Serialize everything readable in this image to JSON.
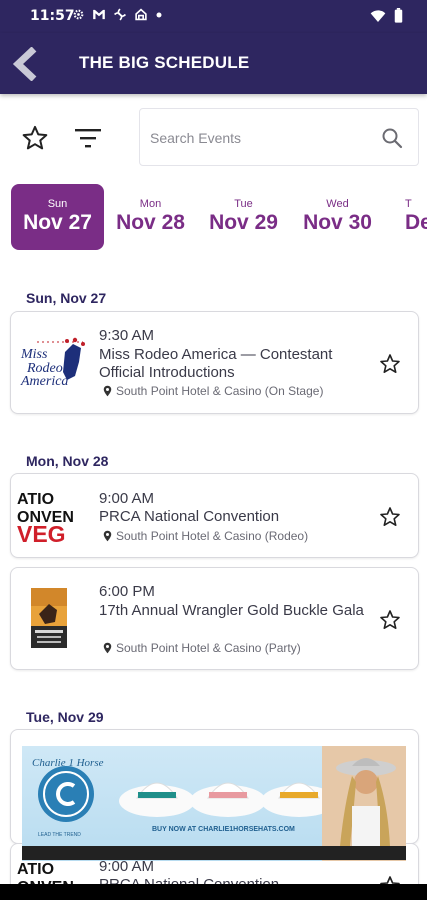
{
  "status_bar": {
    "time": "11:57",
    "icons": [
      "settings-icon",
      "gmail-icon",
      "app-icon",
      "home-icon",
      "dot-icon"
    ],
    "right_icons": [
      "wifi-icon",
      "battery-icon"
    ]
  },
  "app_bar": {
    "title": "THE BIG SCHEDULE",
    "back_icon": "chevron-left-icon",
    "color": "#2e2660"
  },
  "tools": {
    "favorites_icon": "star-outline-icon",
    "filter_icon": "filter-icon",
    "search_placeholder": "Search Events",
    "search_value": ""
  },
  "date_strip": {
    "accent": "#7a2d86",
    "days": [
      {
        "dow": "Sun",
        "date": "Nov 27",
        "selected": true
      },
      {
        "dow": "Mon",
        "date": "Nov 28",
        "selected": false
      },
      {
        "dow": "Tue",
        "date": "Nov 29",
        "selected": false
      },
      {
        "dow": "Wed",
        "date": "Nov 30",
        "selected": false
      },
      {
        "dow": "T",
        "date": "De",
        "selected": false
      }
    ]
  },
  "schedule": [
    {
      "date": "Sun, Nov 27",
      "events": [
        {
          "time": "9:30 AM",
          "name": "Miss Rodeo America — Contestant Official Introductions",
          "location": "South Point Hotel & Casino (On Stage)",
          "logo": "Miss Rodeo America"
        }
      ]
    },
    {
      "date": "Mon, Nov 28",
      "events": [
        {
          "time": "9:00 AM",
          "name": "PRCA National Convention",
          "location": "South Point Hotel & Casino (Rodeo)",
          "logo": "ATIO ONVEN VEG"
        },
        {
          "time": "6:00 PM",
          "name": "17th Annual Wrangler Gold Buckle Gala",
          "location": "South Point Hotel & Casino (Party)",
          "logo": "gala-poster"
        }
      ]
    },
    {
      "date": "Tue, Nov 29",
      "events": [
        {
          "time": "9:00 AM",
          "name": "PRCA National Convention",
          "location": "",
          "logo": "ATIO ONVEN"
        }
      ]
    }
  ],
  "ad": {
    "brand": "Charlie 1 Horse",
    "tagline": "LEAD THE TREND",
    "cta": "BUY NOW AT CHARLIE1HORSEHATS.COM"
  }
}
